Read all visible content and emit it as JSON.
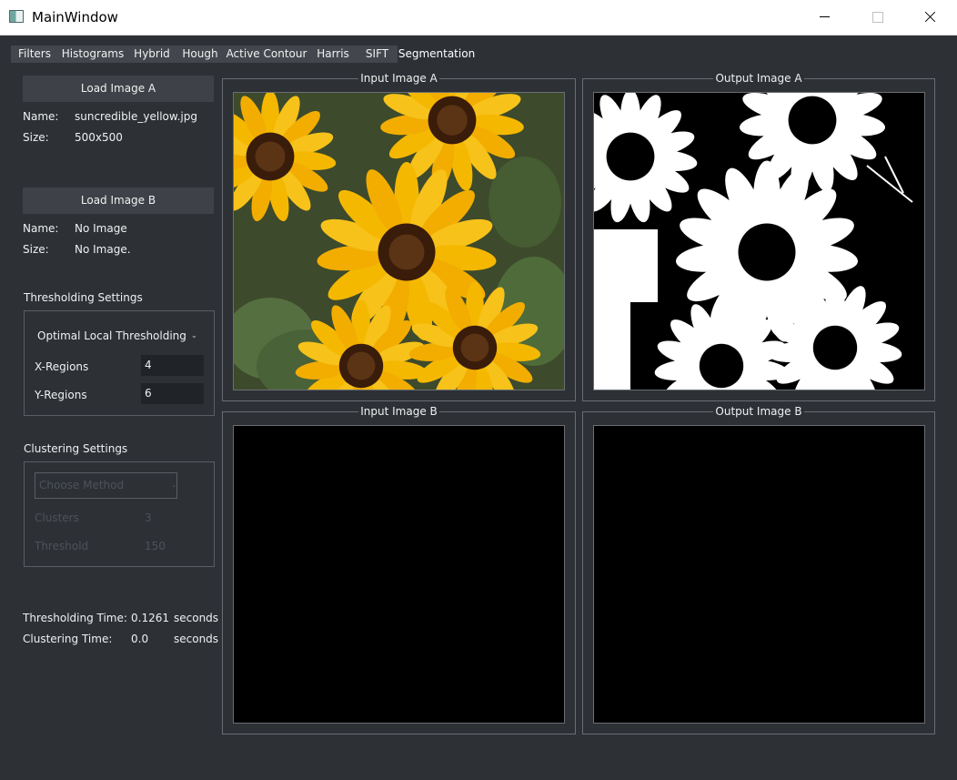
{
  "window": {
    "title": "MainWindow"
  },
  "tabs": [
    "Filters",
    "Histograms",
    "Hybrid",
    "Hough",
    "Active Contour",
    "Harris",
    "SIFT",
    "Segmentation"
  ],
  "active_tab": "Segmentation",
  "image_a": {
    "load_label": "Load Image A",
    "name_label": "Name:",
    "name_value": "suncredible_yellow.jpg",
    "size_label": "Size:",
    "size_value": "500x500"
  },
  "image_b": {
    "load_label": "Load Image B",
    "name_label": "Name:",
    "name_value": "No Image",
    "size_label": "Size:",
    "size_value": "No Image."
  },
  "thresholding": {
    "title": "Thresholding Settings",
    "method": "Optimal Local Thresholding",
    "x_label": "X-Regions",
    "x_value": "4",
    "y_label": "Y-Regions",
    "y_value": "6"
  },
  "clustering": {
    "title": "Clustering Settings",
    "method_placeholder": "Choose Method",
    "clusters_label": "Clusters",
    "clusters_value": "3",
    "threshold_label": "Threshold",
    "threshold_value": "150"
  },
  "timing": {
    "thresholding_label": "Thresholding Time:",
    "thresholding_value": "0.1261",
    "clustering_label": "Clustering Time:",
    "clustering_value": "0.0",
    "unit": "seconds"
  },
  "frames": {
    "input_a": "Input Image A",
    "output_a": "Output Image A",
    "input_b": "Input Image B",
    "output_b": "Output Image B"
  }
}
